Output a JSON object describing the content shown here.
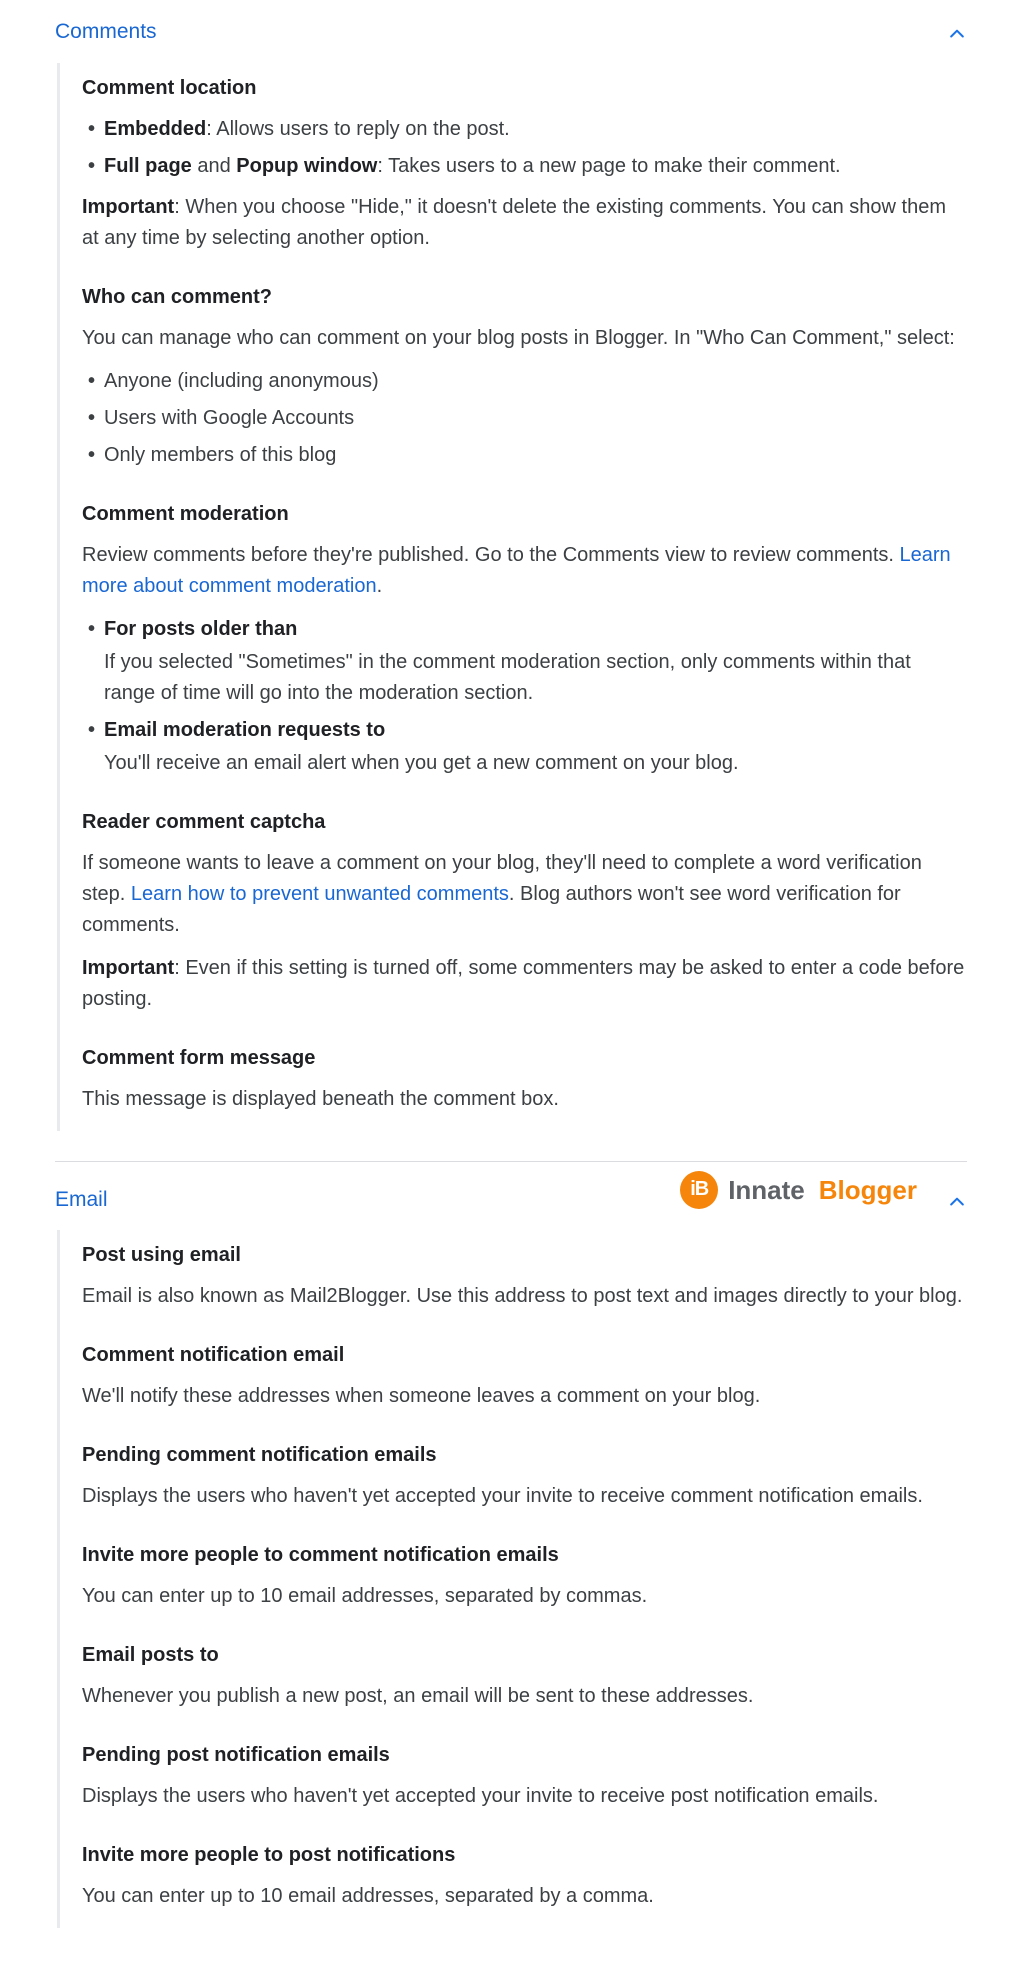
{
  "sections": {
    "comments": {
      "header": "Comments",
      "loc_title": "Comment location",
      "loc_b1_bold": "Embedded",
      "loc_b1_rest": ": Allows users to reply on the post.",
      "loc_b2_bold1": "Full page",
      "loc_b2_mid": " and ",
      "loc_b2_bold2": "Popup window",
      "loc_b2_rest": ": Takes users to a new page to make their comment.",
      "loc_imp_bold": "Important",
      "loc_imp_rest": ": When you choose \"Hide,\" it doesn't delete the existing comments. You can show them at any time by selecting another option.",
      "who_title": "Who can comment?",
      "who_intro": "You can manage who can comment on your blog posts in Blogger. In \"Who Can Comment,\" select:",
      "who_li1": "Anyone (including anonymous)",
      "who_li2": "Users with Google Accounts",
      "who_li3": "Only members of this blog",
      "mod_title": "Comment moderation",
      "mod_text": "Review comments before they're published. Go to the Comments view to review comments. ",
      "mod_link": "Learn more about comment moderation",
      "mod_dot": ".",
      "mod_b1_bold": "For posts older than",
      "mod_b1_sub": "If you selected \"Sometimes\" in the comment moderation section, only comments within that range of time will go into the moderation section.",
      "mod_b2_bold": "Email moderation requests to",
      "mod_b2_sub": "You'll receive an email alert when you get a new comment on your blog.",
      "cap_title": "Reader comment captcha",
      "cap_text1": "If someone wants to leave a comment on your blog, they'll need to complete a word verification step. ",
      "cap_link": "Learn how to prevent unwanted comments",
      "cap_text2": ". Blog authors won't see word verification for comments.",
      "cap_imp_bold": "Important",
      "cap_imp_rest": ": Even if this setting is turned off, some commenters may be asked to enter a code before posting.",
      "form_title": "Comment form message",
      "form_text": "This message is displayed beneath the comment box."
    },
    "email": {
      "header": "Email",
      "s1_t": "Post using email",
      "s1_p": "Email is also known as Mail2Blogger. Use this address to post text and images directly to your blog.",
      "s2_t": "Comment notification email",
      "s2_p": "We'll notify these addresses when someone leaves a comment on your blog.",
      "s3_t": "Pending comment notification emails",
      "s3_p": "Displays the users who haven't yet accepted your invite to receive comment notification emails.",
      "s4_t": "Invite more people to comment notification emails",
      "s4_p": "You can enter up to 10 email addresses, separated by commas.",
      "s5_t": "Email posts to",
      "s5_p": "Whenever you publish a new post, an email will be sent to these addresses.",
      "s6_t": "Pending post notification emails",
      "s6_p": "Displays the users who haven't yet accepted your invite to receive post notification emails.",
      "s7_t": "Invite more people to post notifications",
      "s7_p": "You can enter up to 10 email addresses, separated by a comma."
    }
  },
  "watermark": {
    "badge": "iB",
    "word1": "Innate",
    "word2": "Blogger"
  }
}
